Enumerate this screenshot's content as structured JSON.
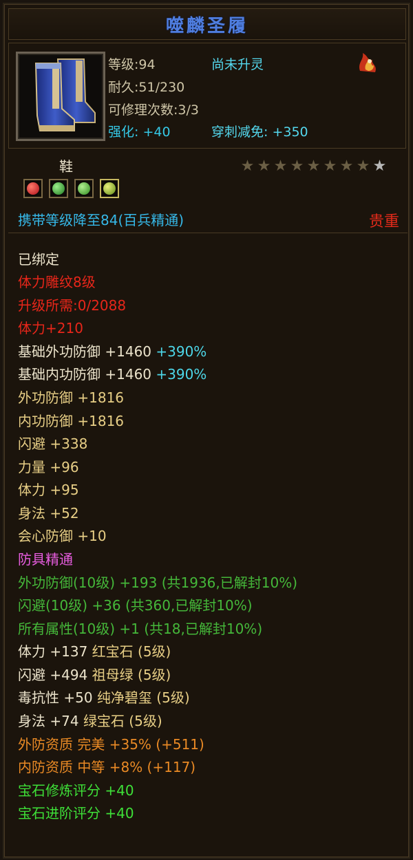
{
  "title": "噬麟圣履",
  "header": {
    "level": "等级:94",
    "durability": "耐久:51/230",
    "repair": "可修理次数:3/3",
    "enhance_label": "强化:",
    "enhance_value": "+40",
    "spirit": "尚未升灵",
    "pierce_label": "穿刺减免:",
    "pierce_value": "+350",
    "badge_icon": "flame-badge-icon"
  },
  "item": {
    "type": "鞋",
    "stars_total": 9,
    "stars_lit": 1,
    "gem_icons": [
      "red-gem-icon",
      "green-gem-icon",
      "green-gem-icon",
      "yellow-green-gem-icon"
    ],
    "carry_text": "携带等级降至84(百兵精通)",
    "rarity": "贵重"
  },
  "attributes": [
    {
      "text": "已绑定",
      "color": "white"
    },
    {
      "text": "体力雕纹8级",
      "color": "red"
    },
    {
      "text": "升级所需:0/2088",
      "color": "red"
    },
    {
      "text": "体力+210",
      "color": "red"
    },
    {
      "text": "基础外功防御 +1460",
      "extra": "+390%",
      "color": "white"
    },
    {
      "text": "基础内功防御 +1460",
      "extra": "+390%",
      "color": "white"
    },
    {
      "text": "外功防御 +1816",
      "color": "gold"
    },
    {
      "text": "内功防御 +1816",
      "color": "gold"
    },
    {
      "text": "闪避 +338",
      "color": "gold"
    },
    {
      "text": "力量 +96",
      "color": "gold"
    },
    {
      "text": "体力 +95",
      "color": "gold"
    },
    {
      "text": "身法 +52",
      "color": "gold"
    },
    {
      "text": "会心防御 +10",
      "color": "gold"
    },
    {
      "text": "防具精通",
      "color": "pink"
    },
    {
      "text": "外功防御(10级) +193 (共1936,已解封10%)",
      "color": "green"
    },
    {
      "text": "闪避(10级) +36 (共360,已解封10%)",
      "color": "green"
    },
    {
      "text": "所有属性(10级) +1 (共18,已解封10%)",
      "color": "green"
    },
    {
      "text": "体力 +137",
      "gem": "红宝石 (5级)",
      "color": "white"
    },
    {
      "text": "闪避 +494",
      "gem": "祖母绿 (5级)",
      "color": "white"
    },
    {
      "text": "毒抗性 +50",
      "gem": "纯净碧玺 (5级)",
      "color": "white"
    },
    {
      "text": "身法 +74",
      "gem": "绿宝石 (5级)",
      "color": "white"
    },
    {
      "text": "外防资质  完美 +35% (+511)",
      "color": "orange"
    },
    {
      "text": "内防资质  中等 +8% (+117)",
      "color": "orange"
    },
    {
      "text": "宝石修炼评分 +40",
      "color": "bright-green"
    },
    {
      "text": "宝石进阶评分 +40",
      "color": "bright-green"
    }
  ]
}
